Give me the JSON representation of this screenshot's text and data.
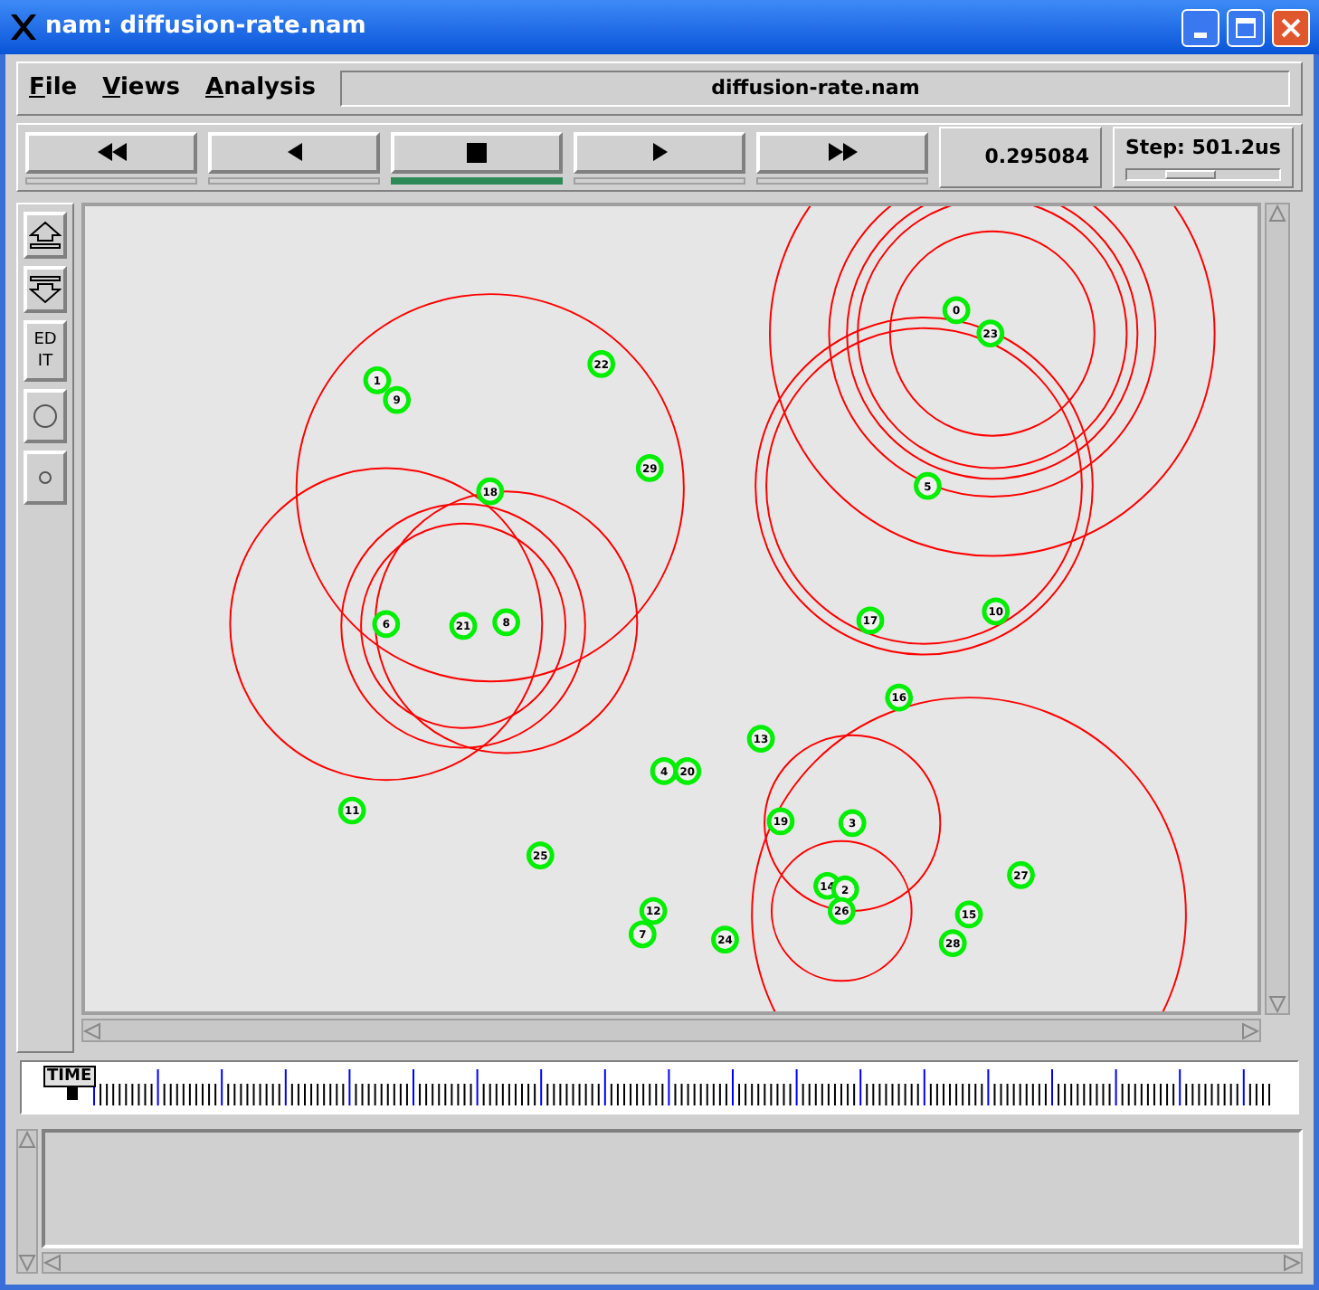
{
  "window": {
    "title": "nam: diffusion-rate.nam"
  },
  "menu": [
    {
      "label": "File"
    },
    {
      "label": "Views"
    },
    {
      "label": "Analysis"
    }
  ],
  "file_name": "diffusion-rate.nam",
  "playback": [
    {
      "kind": "rewind",
      "selected": false
    },
    {
      "kind": "back",
      "selected": false
    },
    {
      "kind": "stop",
      "selected": true
    },
    {
      "kind": "play",
      "selected": false
    },
    {
      "kind": "forward",
      "selected": false
    }
  ],
  "time": "0.295084",
  "step": {
    "label": "Step: 501.2us",
    "level": 0.42
  },
  "tools": [
    {
      "kind": "zoom-in"
    },
    {
      "kind": "zoom-out"
    },
    {
      "kind": "edit",
      "label": "EDIT"
    },
    {
      "kind": "big-circle"
    },
    {
      "kind": "small-circle"
    }
  ],
  "nodes": [
    {
      "label": "0"
    },
    {
      "label": "23"
    },
    {
      "label": "5"
    },
    {
      "label": "17"
    },
    {
      "label": "10"
    },
    {
      "label": "16"
    },
    {
      "label": "1"
    },
    {
      "label": "9"
    },
    {
      "label": "22"
    },
    {
      "label": "29"
    },
    {
      "label": "18"
    },
    {
      "label": "6"
    },
    {
      "label": "21"
    },
    {
      "label": "8"
    },
    {
      "label": "13"
    },
    {
      "label": "4"
    },
    {
      "label": "20"
    },
    {
      "label": "11"
    },
    {
      "label": "25"
    },
    {
      "label": "12"
    },
    {
      "label": "7"
    },
    {
      "label": "24"
    },
    {
      "label": "19"
    },
    {
      "label": "3"
    },
    {
      "label": "14"
    },
    {
      "label": "2"
    },
    {
      "label": "26"
    },
    {
      "label": "27"
    },
    {
      "label": "15"
    },
    {
      "label": "28"
    }
  ],
  "timeline": {
    "marker": "TIME",
    "level": 0.04
  }
}
